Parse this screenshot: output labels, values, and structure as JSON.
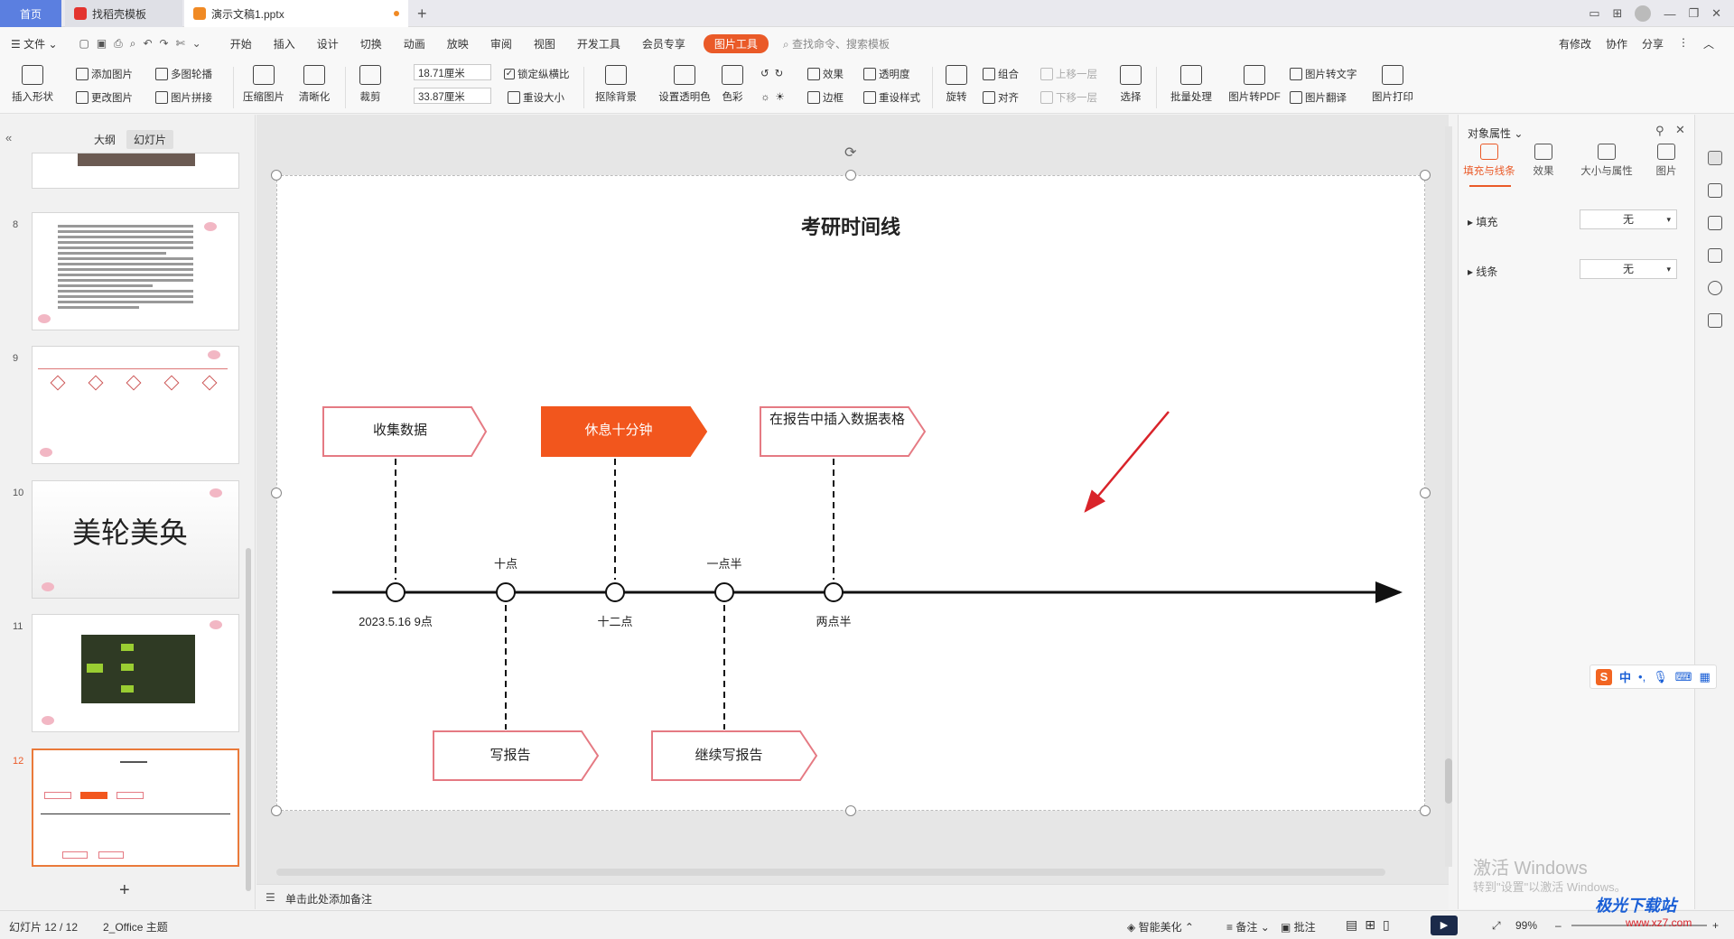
{
  "titlebar": {
    "home": "首页",
    "tab1": "找稻壳模板",
    "tab2": "演示文稿1.pptx"
  },
  "menu": {
    "file": "文件",
    "items": [
      "开始",
      "插入",
      "设计",
      "切换",
      "动画",
      "放映",
      "审阅",
      "视图",
      "开发工具",
      "会员专享"
    ],
    "active_tool": "图片工具",
    "search": "查找命令、搜索模板",
    "right": [
      "有修改",
      "协作",
      "分享"
    ]
  },
  "ribbon": {
    "insert_shape": "插入形状",
    "add_picture": "添加图片",
    "change_picture": "更改图片",
    "multi_outline": "多图轮播",
    "picture_collage": "图片拼接",
    "compress": "压缩图片",
    "sharpen": "清晰化",
    "crop": "裁剪",
    "width": "18.71厘米",
    "height": "33.87厘米",
    "lock_ratio": "锁定纵横比",
    "reset_size": "重设大小",
    "remove_bg": "抠除背景",
    "set_transparent": "设置透明色",
    "color": "色彩",
    "effect": "效果",
    "transparency": "透明度",
    "border": "边框",
    "reset_style": "重设样式",
    "rotate": "旋转",
    "group": "组合",
    "align": "对齐",
    "bring_forward": "上移一层",
    "send_backward": "下移一层",
    "select": "选择",
    "batch": "批量处理",
    "to_pdf": "图片转PDF",
    "to_text": "图片转文字",
    "translate": "图片翻译",
    "print": "图片打印"
  },
  "leftpanel": {
    "tab_outline": "大纲",
    "tab_slides": "幻灯片",
    "slide_numbers": [
      "8",
      "9",
      "10",
      "11",
      "12"
    ],
    "slide10_text": "美轮美奂",
    "add": "+"
  },
  "slide": {
    "title": "考研时间线",
    "top_boxes": [
      "收集数据",
      "休息十分钟",
      "在报告中插入数据表格"
    ],
    "bottom_boxes": [
      "写报告",
      "继续写报告"
    ],
    "labels_above": [
      "十点",
      "一点半"
    ],
    "labels_below": [
      "2023.5.16 9点",
      "十二点",
      "两点半"
    ],
    "highlight_color": "#f2561d",
    "box_border_color": "#e57a83",
    "arrow_color": "#d9232a"
  },
  "rightpane": {
    "title": "对象属性",
    "tabs": [
      "填充与线条",
      "效果",
      "大小与属性",
      "图片"
    ],
    "fill_label": "填充",
    "fill_value": "无",
    "line_label": "线条",
    "line_value": "无"
  },
  "notes": {
    "placeholder": "单击此处添加备注"
  },
  "status": {
    "slide_info": "幻灯片 12 / 12",
    "theme": "2_Office 主题",
    "smart": "智能美化",
    "notes": "备注",
    "comments": "批注",
    "zoom": "99%"
  },
  "overlay": {
    "watermark_line1": "激活 Windows",
    "watermark_line2": "转到\"设置\"以激活 Windows。",
    "ime": "中",
    "site": "极光下载站",
    "site_url": "www.xz7.com"
  }
}
